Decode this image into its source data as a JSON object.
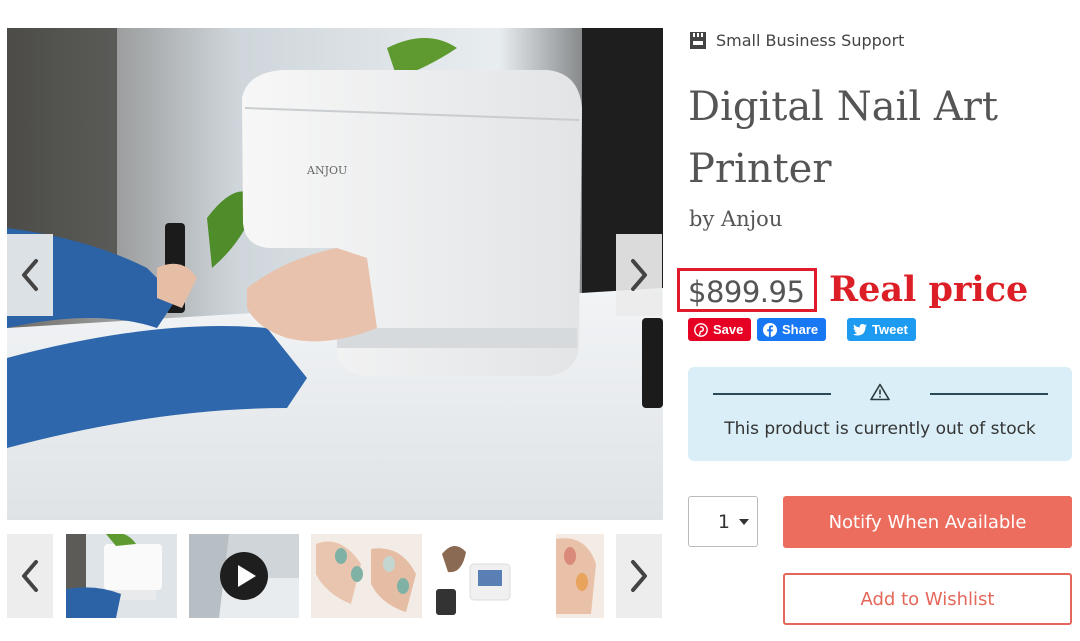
{
  "badge": {
    "icon": "storefront-icon",
    "label": "Small Business Support"
  },
  "product": {
    "title": "Digital Nail Art Printer",
    "vendor": "by Anjou",
    "price": "$899.95",
    "device_brand": "ANJOU"
  },
  "annotation": {
    "label": "Real price",
    "color": "#dc1f26"
  },
  "share": {
    "pinterest": {
      "icon": "pinterest-icon",
      "label": "Save"
    },
    "facebook": {
      "icon": "facebook-icon",
      "label": "Share"
    },
    "twitter": {
      "icon": "twitter-icon",
      "label": "Tweet"
    }
  },
  "stock": {
    "icon": "warning-icon",
    "message": "This product is currently out of stock"
  },
  "purchase": {
    "quantity": "1",
    "notify_label": "Notify When Available",
    "wishlist_label": "Add to Wishlist"
  },
  "gallery": {
    "prev_icon": "chevron-left-icon",
    "next_icon": "chevron-right-icon",
    "thumbnails": [
      {
        "kind": "image",
        "subject": "printer in use"
      },
      {
        "kind": "video",
        "subject": "demo video"
      },
      {
        "kind": "image",
        "subject": "painted nails"
      },
      {
        "kind": "image",
        "subject": "printer with phone"
      },
      {
        "kind": "image",
        "subject": "nail close-up"
      }
    ]
  },
  "colors": {
    "accent": "#ec6d5e",
    "stock_bg": "#d9eef6",
    "highlight": "#e01b2b"
  }
}
